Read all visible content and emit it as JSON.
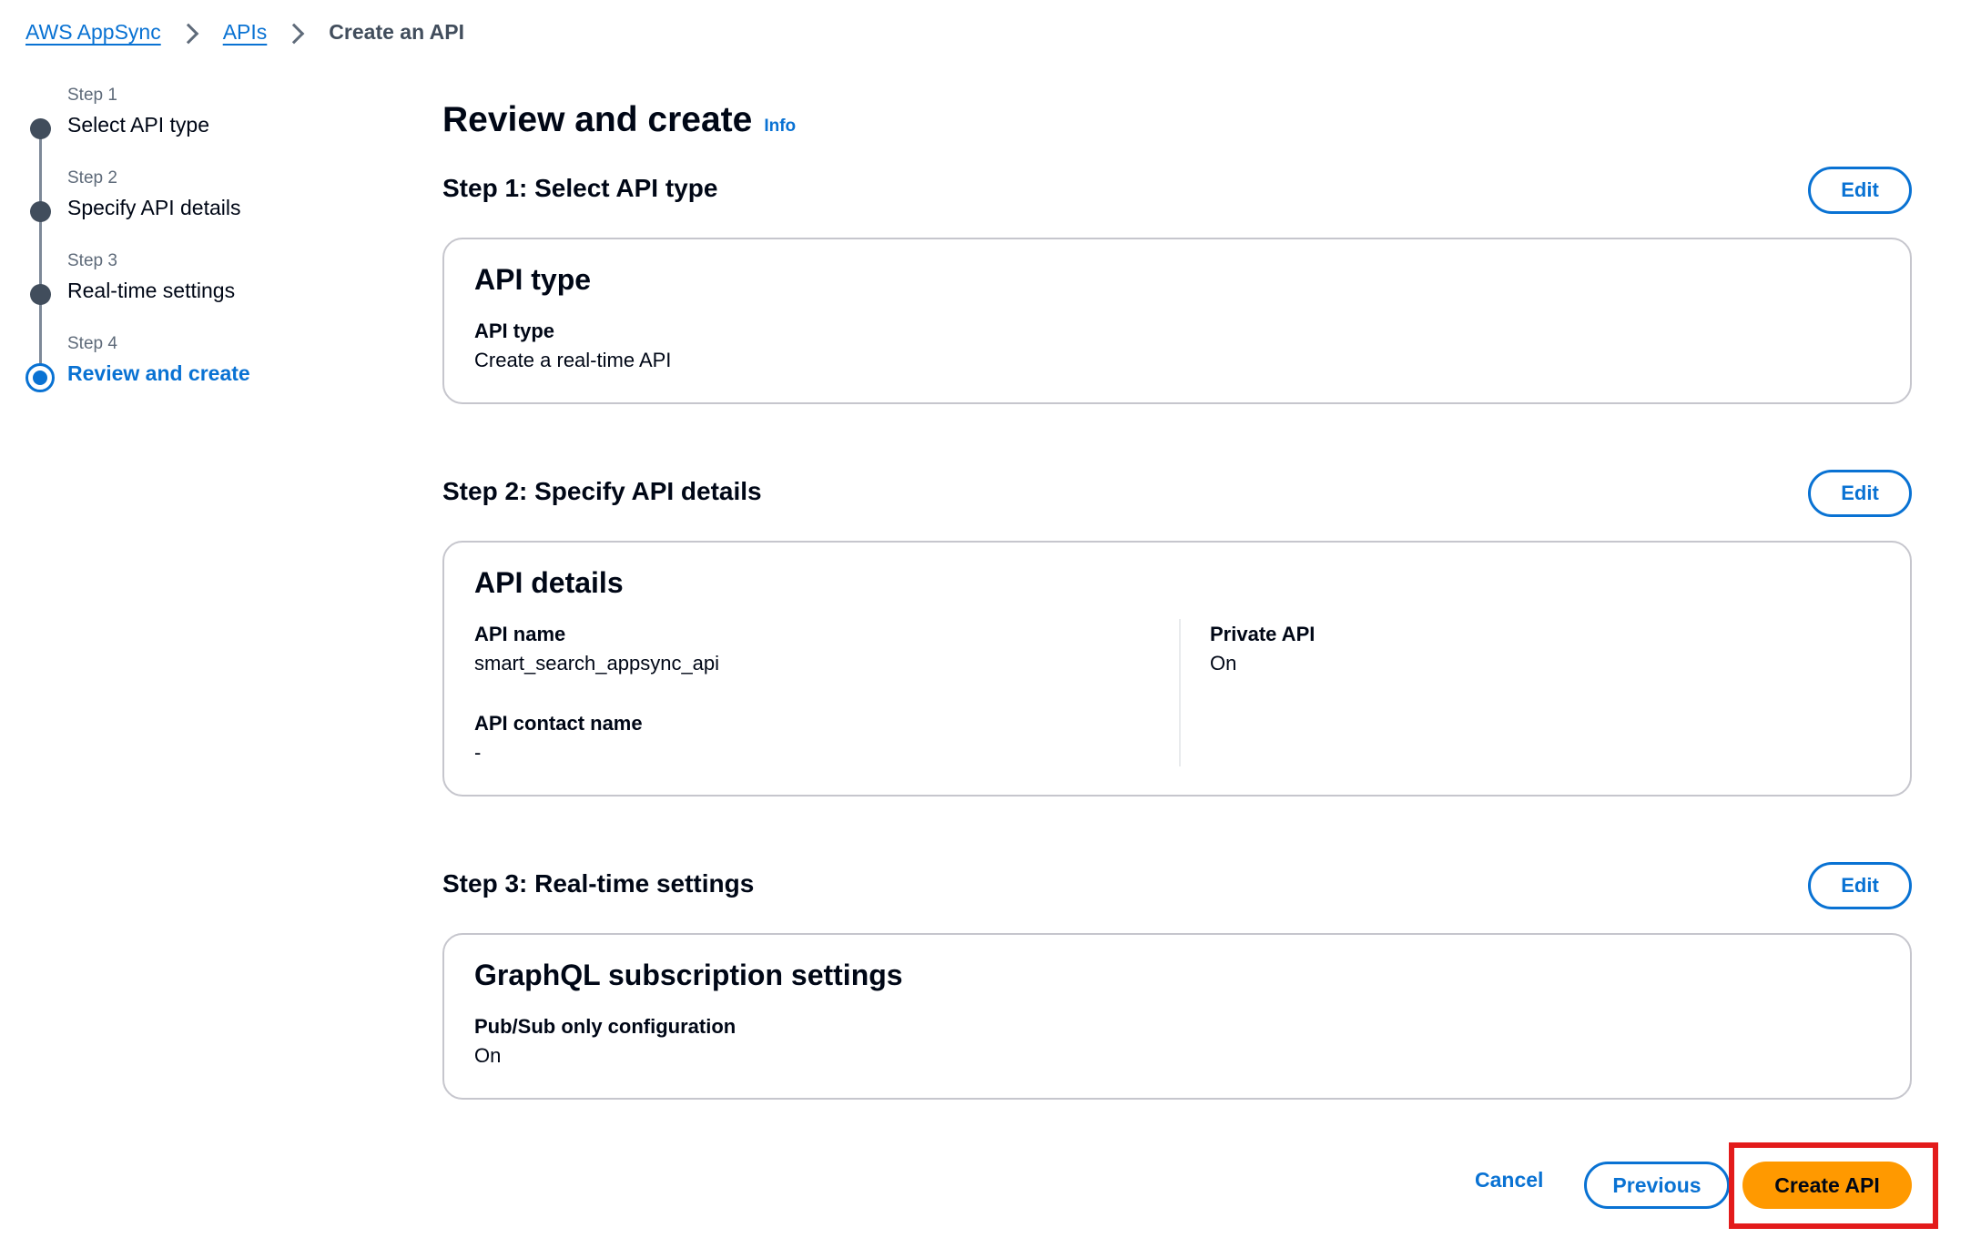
{
  "breadcrumb": {
    "items": [
      "AWS AppSync",
      "APIs"
    ],
    "current": "Create an API"
  },
  "wizard": {
    "steps": [
      {
        "number": "Step 1",
        "title": "Select API type",
        "state": "completed"
      },
      {
        "number": "Step 2",
        "title": "Specify API details",
        "state": "completed"
      },
      {
        "number": "Step 3",
        "title": "Real-time settings",
        "state": "completed"
      },
      {
        "number": "Step 4",
        "title": "Review and create",
        "state": "active"
      }
    ]
  },
  "page": {
    "title": "Review and create",
    "info_label": "Info"
  },
  "sections": {
    "step1": {
      "title": "Step 1: Select API type",
      "edit_label": "Edit",
      "card_title": "API type",
      "fields": [
        {
          "label": "API type",
          "value": "Create a real-time API"
        }
      ]
    },
    "step2": {
      "title": "Step 2: Specify API details",
      "edit_label": "Edit",
      "card_title": "API details",
      "fields": [
        {
          "label": "API name",
          "value": "smart_search_appsync_api"
        },
        {
          "label": "API contact name",
          "value": "-"
        },
        {
          "label": "Private API",
          "value": "On"
        }
      ]
    },
    "step3": {
      "title": "Step 3: Real-time settings",
      "edit_label": "Edit",
      "card_title": "GraphQL subscription settings",
      "fields": [
        {
          "label": "Pub/Sub only configuration",
          "value": "On"
        }
      ]
    }
  },
  "actions": {
    "cancel": "Cancel",
    "previous": "Previous",
    "create": "Create API"
  },
  "colors": {
    "link": "#0972d3",
    "primary_button": "#ff9900",
    "highlight": "#e31b1b"
  }
}
